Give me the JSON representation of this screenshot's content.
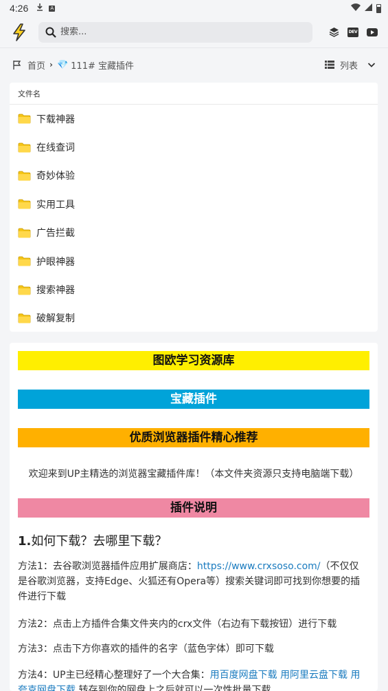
{
  "status_bar": {
    "time": "4:26"
  },
  "app_bar": {
    "search_placeholder": "搜索...",
    "dev_label": "DEV"
  },
  "breadcrumb": {
    "home": "首页",
    "current_icon": "💎",
    "current": "111# 宝藏插件",
    "view_label": "列表"
  },
  "file_list": {
    "header": "文件名",
    "items": [
      {
        "name": "下载神器"
      },
      {
        "name": "在线查词"
      },
      {
        "name": "奇妙体验"
      },
      {
        "name": "实用工具"
      },
      {
        "name": "广告拦截"
      },
      {
        "name": "护眼神器"
      },
      {
        "name": "搜索神器"
      },
      {
        "name": "破解复制"
      }
    ]
  },
  "readme": {
    "banner_1": "图欧学习资源库",
    "banner_2": "宝藏插件",
    "banner_3": "优质浏览器插件精心推荐",
    "welcome": "欢迎来到UP主精选的浏览器宝藏插件库！（本文件夹资源只支持电脑端下载）",
    "banner_4": "插件说明",
    "heading_num": "1.",
    "heading_text": "如何下载？去哪里下载？",
    "method1_prefix": "方法1：去谷歌浏览器插件应用扩展商店：",
    "method1_link": "https://www.crxsoso.com/",
    "method1_suffix": "（不仅仅是谷歌浏览器，支持Edge、火狐还有Opera等）搜索关键词即可找到你想要的插件进行下载",
    "method2": "方法2：点击上方插件合集文件夹内的crx文件（右边有下载按钮）进行下载",
    "method3": "方法3：点击下方你喜欢的插件的名字（蓝色字体）即可下载",
    "method4_prefix": "方法4：UP主已经精心整理好了一个大合集：",
    "method4_link1": "用百度网盘下载",
    "method4_link2": "用阿里云盘下载",
    "method4_link3": "用夸克网盘下载",
    "method4_suffix": "转存到你的网盘上之后就可以一次性批量下载"
  },
  "colors": {
    "banner_yellow": "#ffef00",
    "banner_blue": "#00a3d9",
    "banner_orange": "#ffb000",
    "banner_pink": "#ef88a3",
    "link": "#1a7bbf"
  }
}
